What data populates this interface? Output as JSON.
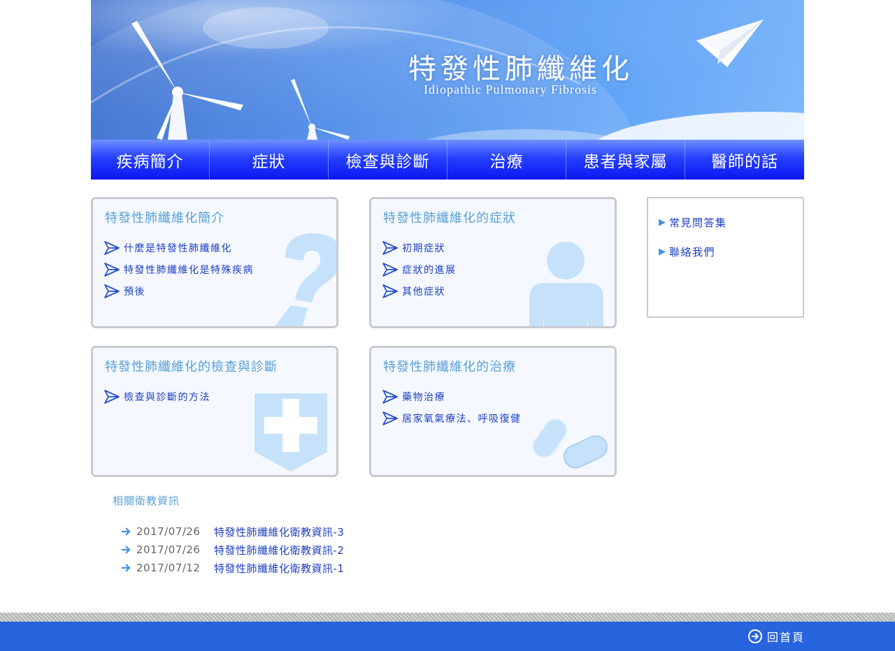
{
  "banner": {
    "title": "特發性肺纖維化",
    "subtitle": "Idiopathic Pulmonary Fibrosis",
    "decor": [
      "wind-turbine-icon",
      "paper-plane-icon"
    ]
  },
  "nav": {
    "items": [
      {
        "label": "疾病簡介"
      },
      {
        "label": "症狀"
      },
      {
        "label": "檢查與診斷"
      },
      {
        "label": "治療"
      },
      {
        "label": "患者與家屬"
      },
      {
        "label": "醫師的話"
      }
    ]
  },
  "cards": [
    {
      "title": "特發性肺纖維化簡介",
      "links": [
        "什麼是特發性肺纖維化",
        "特發性肺纖維化是特殊疾病",
        "預後"
      ],
      "icon": "question-mark-icon"
    },
    {
      "title": "特發性肺纖維化的症狀",
      "links": [
        "初期症狀",
        "症狀的進展",
        "其他症狀"
      ],
      "icon": "person-icon"
    },
    {
      "title": "特發性肺纖維化的檢查與診斷",
      "links": [
        "檢查與診斷的方法"
      ],
      "icon": "medical-cross-icon"
    },
    {
      "title": "特發性肺纖維化的治療",
      "links": [
        "藥物治療",
        "居家氧氣療法、呼吸復健"
      ],
      "icon": "pill-icon"
    }
  ],
  "side": {
    "links": [
      "常見問答集",
      "聯絡我們"
    ]
  },
  "news": {
    "heading": "相關衛教資訊",
    "items": [
      {
        "date": "2017/07/26",
        "title": "特發性肺纖維化衛教資訊-3"
      },
      {
        "date": "2017/07/26",
        "title": "特發性肺纖維化衛教資訊-2"
      },
      {
        "date": "2017/07/12",
        "title": "特發性肺纖維化衛教資訊-1"
      }
    ]
  },
  "footer": {
    "home_label": "回首頁"
  },
  "colors": {
    "nav_blue": "#1020f0",
    "link_blue": "#1f3fc2",
    "heading_blue": "#5a9fd6",
    "footer_blue": "#2764de",
    "deco_light_blue": "#c6e2fb"
  }
}
